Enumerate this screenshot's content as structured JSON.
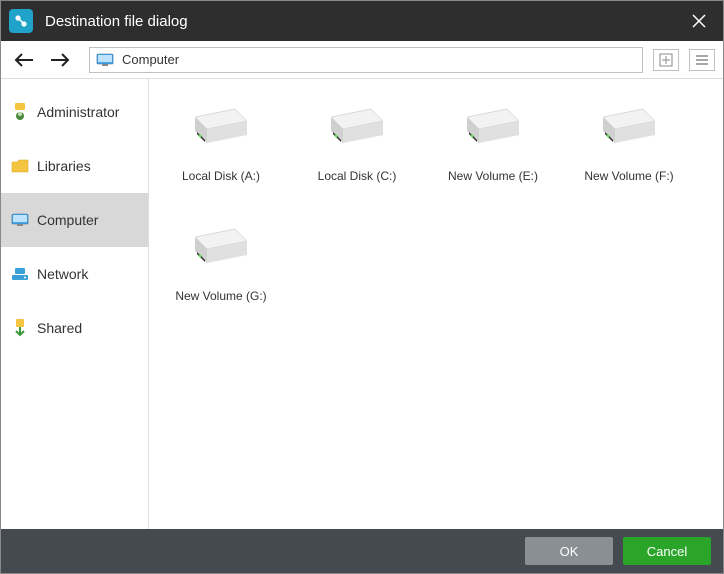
{
  "title": "Destination file dialog",
  "path": "Computer",
  "sidebar": {
    "items": [
      {
        "label": "Administrator",
        "icon": "user",
        "selected": false
      },
      {
        "label": "Libraries",
        "icon": "folder",
        "selected": false
      },
      {
        "label": "Computer",
        "icon": "monitor",
        "selected": true
      },
      {
        "label": "Network",
        "icon": "network",
        "selected": false
      },
      {
        "label": "Shared",
        "icon": "shared",
        "selected": false
      }
    ]
  },
  "drives": [
    {
      "label": "Local Disk (A:)"
    },
    {
      "label": "Local Disk (C:)"
    },
    {
      "label": "New Volume (E:)"
    },
    {
      "label": "New Volume (F:)"
    },
    {
      "label": "New Volume (G:)"
    }
  ],
  "footer": {
    "ok": "OK",
    "cancel": "Cancel"
  }
}
